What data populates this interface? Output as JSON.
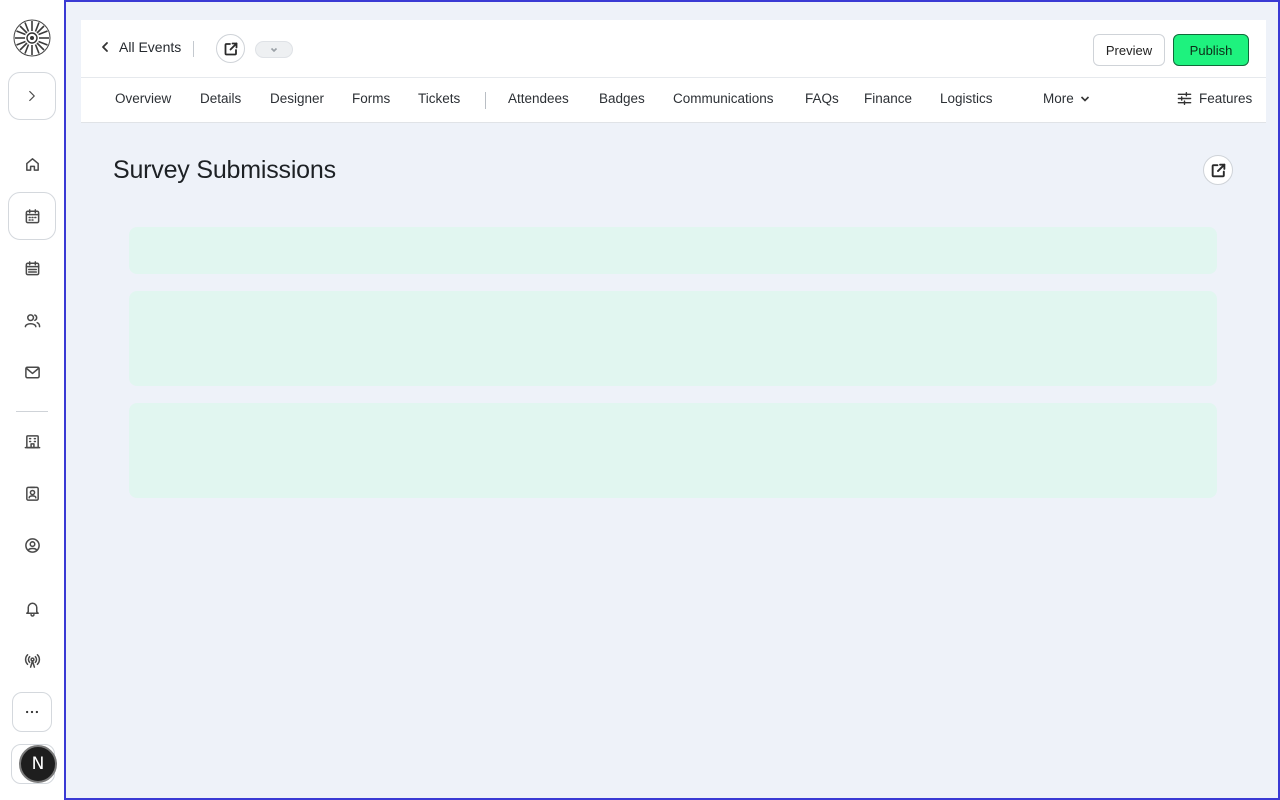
{
  "header": {
    "back_label": "All Events",
    "preview_label": "Preview",
    "publish_label": "Publish"
  },
  "tabs": {
    "items": [
      {
        "label": "Overview"
      },
      {
        "label": "Details"
      },
      {
        "label": "Designer"
      },
      {
        "label": "Forms"
      },
      {
        "label": "Tickets"
      },
      {
        "label": "Attendees"
      },
      {
        "label": "Badges"
      },
      {
        "label": "Communications"
      },
      {
        "label": "FAQs"
      },
      {
        "label": "Finance"
      },
      {
        "label": "Logistics"
      }
    ],
    "more_label": "More",
    "features_label": "Features"
  },
  "main": {
    "title": "Survey Submissions"
  },
  "user": {
    "avatar_initial": "N"
  },
  "colors": {
    "accent": "#1ef27e",
    "frame_border": "#3a3ad4",
    "skeleton": "#e1f6f0",
    "background": "#eef2f9"
  }
}
